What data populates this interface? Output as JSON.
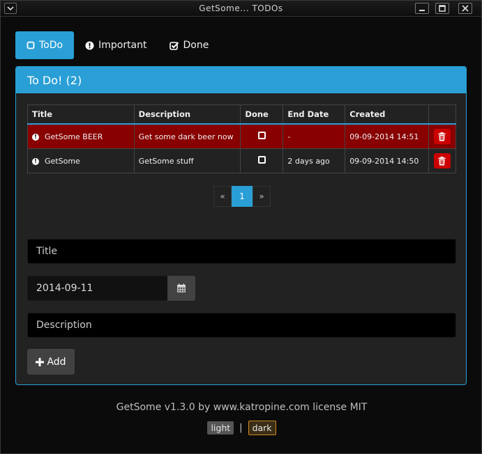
{
  "window": {
    "title": "GetSome... TODOs"
  },
  "tabs": [
    {
      "label": "ToDo",
      "icon": "square-icon",
      "active": true
    },
    {
      "label": "Important",
      "icon": "exclamation-circle-icon",
      "active": false
    },
    {
      "label": "Done",
      "icon": "check-square-icon",
      "active": false
    }
  ],
  "panel": {
    "title": "To Do! (2)"
  },
  "table": {
    "headers": [
      "Title",
      "Description",
      "Done",
      "End Date",
      "Created"
    ],
    "rows": [
      {
        "title": "GetSome BEER",
        "description": "Get some dark beer now",
        "end_date": "-",
        "created": "09-09-2014 14:51"
      },
      {
        "title": "GetSome",
        "description": "GetSome stuff",
        "end_date": "2 days ago",
        "created": "09-09-2014 14:50"
      }
    ]
  },
  "pagination": {
    "prev": "«",
    "current": "1",
    "next": "»"
  },
  "form": {
    "title_placeholder": "Title",
    "date_value": "2014-09-11",
    "description_placeholder": "Description",
    "add_label": "Add"
  },
  "footer": {
    "text": "GetSome v1.3.0 by www.katropine.com license MIT",
    "theme_light": "light",
    "separator": "|",
    "theme_dark": "dark"
  },
  "colors": {
    "accent": "#2a9fd6",
    "important_row": "#880000",
    "delete": "#cc0000"
  }
}
